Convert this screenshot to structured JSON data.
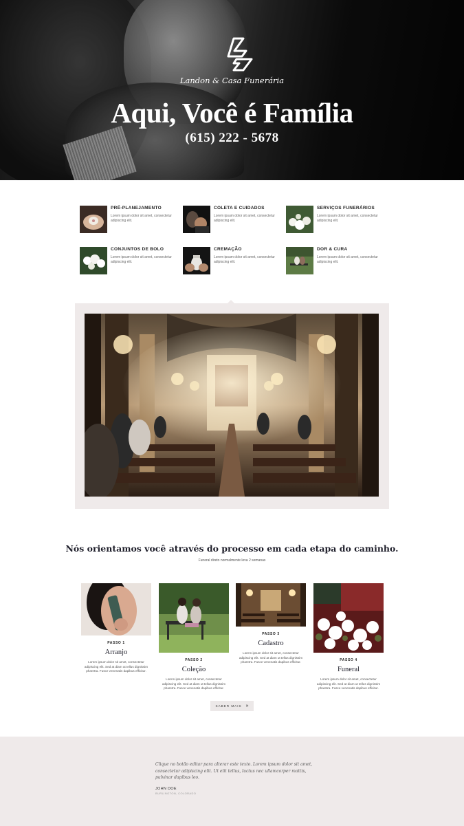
{
  "hero": {
    "brand": "Landon & Casa Funerária",
    "title": "Aqui, Você é Família",
    "phone": "(615) 222 - 5678"
  },
  "services": [
    {
      "name": "PRÉ-PLANEJAMENTO",
      "desc": "Lorem ipsum dolor sit amet, consectetur adipiscing elit.",
      "icon": "hands-photo"
    },
    {
      "name": "COLETA E CUIDADOS",
      "desc": "Lorem ipsum dolor sit amet, consectetur adipiscing elit.",
      "icon": "hands-photo"
    },
    {
      "name": "SERVIÇOS FUNERÁRIOS",
      "desc": "Lorem ipsum dolor sit amet, consectetur adipiscing elit.",
      "icon": "flowers-photo"
    },
    {
      "name": "CONJUNTOS DE BOLO",
      "desc": "Lorem ipsum dolor sit amet, consectetur adipiscing elit.",
      "icon": "flowers-photo"
    },
    {
      "name": "CREMAÇÃO",
      "desc": "Lorem ipsum dolor sit amet, consectetur adipiscing elit.",
      "icon": "urn-photo"
    },
    {
      "name": "DOR & CURA",
      "desc": "Lorem ipsum dolor sit amet, consectetur adipiscing elit.",
      "icon": "bench-photo"
    }
  ],
  "process": {
    "title": "Nós orientamos você através do processo em cada etapa do caminho.",
    "subtitle": "Funeral direto normalmente leva 2 semanas",
    "steps": [
      {
        "label": "PASSO 1",
        "title": "Arranjo",
        "text": "Lorem ipsum dolor sit amet, consectetur adipiscing elit. Sed at diam ut tellus dignissim pharetra. Fusce venenatis dapibus efficitur."
      },
      {
        "label": "PASSO 2",
        "title": "Coleção",
        "text": "Lorem ipsum dolor sit amet, consectetur adipiscing elit. Sed at diam ut tellus dignissim pharetra. Fusce venenatis dapibus efficitur."
      },
      {
        "label": "PASSO 3",
        "title": "Cadastro",
        "text": "Lorem ipsum dolor sit amet, consectetur adipiscing elit. Sed at diam ut tellus dignissim pharetra. Fusce venenatis dapibus efficitur."
      },
      {
        "label": "PASSO 4",
        "title": "Funeral",
        "text": "Lorem ipsum dolor sit amet, consectetur adipiscing elit. Sed at diam ut tellus dignissim pharetra. Fusce venenatis dapibus efficitur."
      }
    ],
    "button": "SABER MAIS",
    "button_icon": "»"
  },
  "testimonial": {
    "quote": "Clique no botão editar para alterar este texto. Lorem ipsum dolor sit amet, consectetur adipiscing elit. Ut elit tellus, luctus nec ullamcorper mattis, pulvinar dapibus leo.",
    "author": "JOHN DOE",
    "location": "BURLINGTON, COLORADO"
  },
  "colors": {
    "panel": "#efeaea",
    "heading": "#1e1e2a"
  }
}
